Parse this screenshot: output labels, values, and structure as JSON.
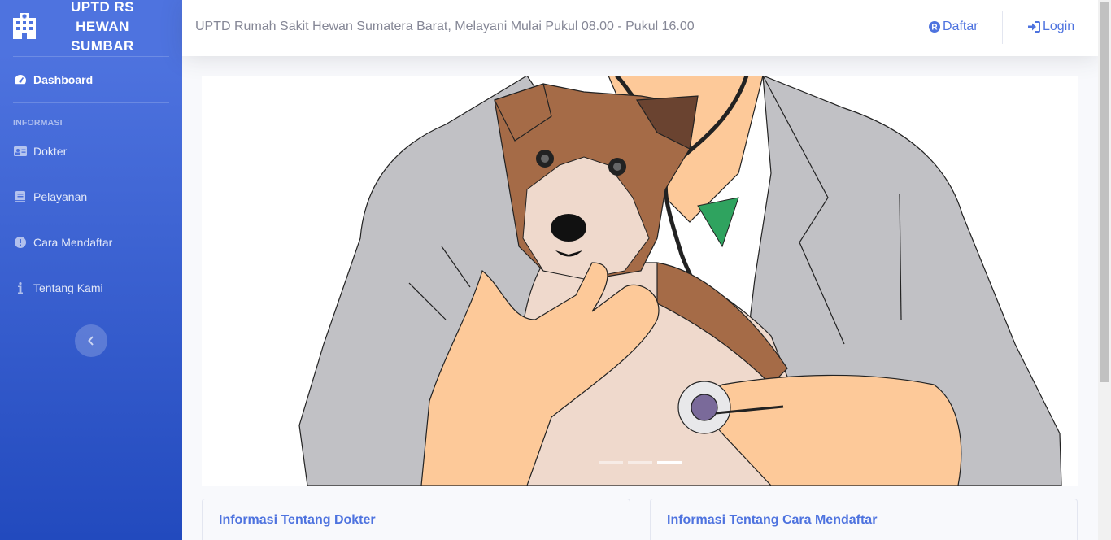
{
  "sidebar": {
    "brand": "UPTD RS HEWAN SUMBAR",
    "heading": "INFORMASI",
    "items": [
      {
        "label": "Dashboard",
        "icon": "tachometer-icon",
        "active": true
      },
      {
        "label": "Dokter",
        "icon": "id-card-icon"
      },
      {
        "label": "Pelayanan",
        "icon": "book-icon"
      },
      {
        "label": "Cara Mendaftar",
        "icon": "exclamation-circle-icon"
      },
      {
        "label": "Tentang Kami",
        "icon": "info-icon"
      }
    ]
  },
  "topbar": {
    "title": "UPTD Rumah Sakit Hewan Sumatera Barat, Melayani Mulai Pukul 08.00 - Pukul 16.00",
    "register_label": "Daftar",
    "login_label": "Login"
  },
  "carousel": {
    "slides": 3,
    "active_index": 2
  },
  "cards": [
    {
      "title": "Informasi Tentang Dokter"
    },
    {
      "title": "Informasi Tentang Cara Mendaftar"
    }
  ],
  "colors": {
    "primary": "#4e73df",
    "sidebar_gradient_end": "#224abe",
    "text_muted": "#858796"
  }
}
